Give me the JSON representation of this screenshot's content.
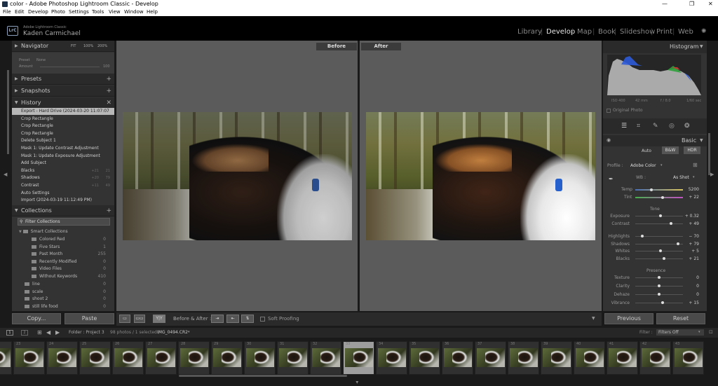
{
  "window": {
    "title": "color - Adobe Photoshop Lightroom Classic - Develop"
  },
  "menu": [
    "File",
    "Edit",
    "Develop",
    "Photo",
    "Settings",
    "Tools",
    "View",
    "Window",
    "Help"
  ],
  "identity": {
    "app": "Adobe Lightroom Classic",
    "user": "Kaden Carmichael",
    "badge": "LrC"
  },
  "modules": [
    "Library",
    "Develop",
    "Map",
    "Book",
    "Slideshow",
    "Print",
    "Web"
  ],
  "active_module": "Develop",
  "left": {
    "navigator": {
      "title": "Navigator",
      "zoom": [
        "FIT",
        "100%",
        "200%"
      ],
      "preset_label": "Preset",
      "preset_value": "None",
      "amount_label": "Amount",
      "amount_value": "100"
    },
    "presets": "Presets",
    "snapshots": "Snapshots",
    "history": {
      "title": "History",
      "items": [
        {
          "label": "Export - Hard Drive (2024-03-20 11:07:07 PM)",
          "a": "",
          "b": ""
        },
        {
          "label": "Crop Rectangle",
          "a": "",
          "b": ""
        },
        {
          "label": "Crop Rectangle",
          "a": "",
          "b": ""
        },
        {
          "label": "Crop Rectangle",
          "a": "",
          "b": ""
        },
        {
          "label": "Delete Subject 1",
          "a": "",
          "b": ""
        },
        {
          "label": "Mask 1: Update Contrast Adjustment",
          "a": "",
          "b": ""
        },
        {
          "label": "Mask 1: Update Exposure Adjustment",
          "a": "",
          "b": ""
        },
        {
          "label": "Add Subject",
          "a": "",
          "b": ""
        },
        {
          "label": "Blacks",
          "a": "+21",
          "b": "21"
        },
        {
          "label": "Shadows",
          "a": "+20",
          "b": "79"
        },
        {
          "label": "Contrast",
          "a": "+11",
          "b": "49"
        },
        {
          "label": "Auto Settings",
          "a": "",
          "b": ""
        },
        {
          "label": "Import (2024-03-19 11:12:49 PM)",
          "a": "",
          "b": ""
        }
      ]
    },
    "collections": {
      "title": "Collections",
      "filter": "Filter Collections",
      "smart": "Smart Collections",
      "smart_items": [
        {
          "name": "Colored Red",
          "count": "0"
        },
        {
          "name": "Five Stars",
          "count": "1"
        },
        {
          "name": "Past Month",
          "count": "255"
        },
        {
          "name": "Recently Modified",
          "count": "0"
        },
        {
          "name": "Video Files",
          "count": "0"
        },
        {
          "name": "Without Keywords",
          "count": "410"
        }
      ],
      "items": [
        {
          "name": "line",
          "count": "0"
        },
        {
          "name": "scale",
          "count": "0"
        },
        {
          "name": "shoot 2",
          "count": "0"
        },
        {
          "name": "still life food",
          "count": "0"
        }
      ]
    },
    "copy": "Copy...",
    "paste": "Paste"
  },
  "center": {
    "before": "Before",
    "after": "After",
    "before_after_label": "Before & After :",
    "soft_proofing": "Soft Proofing"
  },
  "right": {
    "histogram": {
      "title": "Histogram",
      "info": [
        "ISO 400",
        "42 mm",
        "f / 8.0",
        "1/60 sec"
      ],
      "original_photo": "Original Photo"
    },
    "basic": {
      "title": "Basic",
      "auto": "Auto",
      "bw": "B&W",
      "hdr": "HDR",
      "profile_label": "Profile :",
      "profile_value": "Adobe Color",
      "wb_label": "WB :",
      "wb_value": "As Shot",
      "temp_label": "Temp",
      "temp_value": "5200",
      "tint_label": "Tint",
      "tint_value": "+ 22",
      "tone_title": "Tone",
      "tone": [
        {
          "label": "Exposure",
          "value": "+ 0.32",
          "level": 0.53
        },
        {
          "label": "Contrast",
          "value": "+ 49",
          "level": 0.745
        }
      ],
      "tone2": [
        {
          "label": "Highlights",
          "value": "− 70",
          "level": 0.15
        },
        {
          "label": "Shadows",
          "value": "+ 79",
          "level": 0.895
        },
        {
          "label": "Whites",
          "value": "+ 5",
          "level": 0.525
        },
        {
          "label": "Blacks",
          "value": "+ 21",
          "level": 0.605
        }
      ],
      "presence_title": "Presence",
      "presence": [
        {
          "label": "Texture",
          "value": "0",
          "level": 0.5
        },
        {
          "label": "Clarity",
          "value": "0",
          "level": 0.5
        },
        {
          "label": "Dehaze",
          "value": "0",
          "level": 0.5
        },
        {
          "label": "Vibrance",
          "value": "+ 15",
          "level": 0.575
        }
      ]
    },
    "previous": "Previous",
    "reset": "Reset"
  },
  "filmbar": {
    "folder": "Folder : Project 3",
    "count": "98 photos / 1 selected /",
    "file": "IMG_0494.CR2",
    "filter_label": "Filter :",
    "filter_value": "Filters Off"
  },
  "filmstrip": [
    "",
    "23",
    "24",
    "25",
    "26",
    "27",
    "28",
    "29",
    "30",
    "31",
    "32",
    "33",
    "34",
    "35",
    "36",
    "37",
    "38",
    "39",
    "40",
    "41",
    "42",
    "43"
  ],
  "filmstrip_selected": 11,
  "colors": {
    "accent": "#e6e6e6",
    "panel": "#333333",
    "selected": "#b8b8b8",
    "collar": "#2b5bb5"
  }
}
